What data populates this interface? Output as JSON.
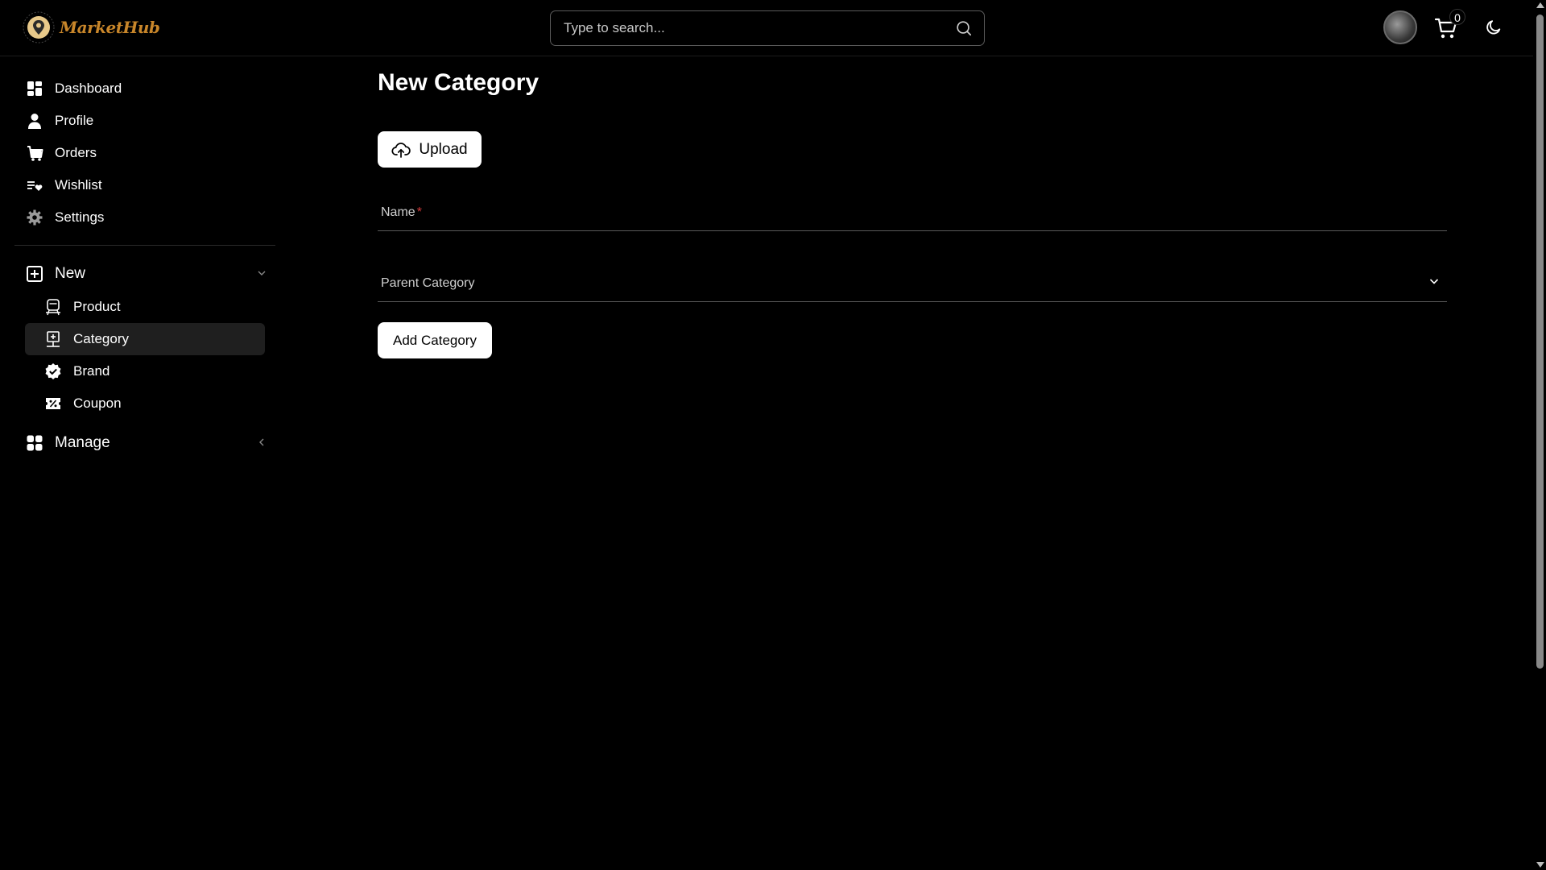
{
  "header": {
    "logo_text": "MarketHub",
    "search_placeholder": "Type to search...",
    "cart_count": "0"
  },
  "sidebar": {
    "items": [
      {
        "label": "Dashboard",
        "icon": "dashboard-icon"
      },
      {
        "label": "Profile",
        "icon": "user-icon"
      },
      {
        "label": "Orders",
        "icon": "orders-icon"
      },
      {
        "label": "Wishlist",
        "icon": "wishlist-icon"
      },
      {
        "label": "Settings",
        "icon": "gear-icon"
      }
    ],
    "new_group": {
      "label": "New",
      "expanded": true,
      "items": [
        {
          "label": "Product",
          "icon": "product-icon"
        },
        {
          "label": "Category",
          "icon": "category-icon",
          "active": true
        },
        {
          "label": "Brand",
          "icon": "brand-badge-icon"
        },
        {
          "label": "Coupon",
          "icon": "coupon-icon"
        }
      ]
    },
    "manage_group": {
      "label": "Manage",
      "expanded": false
    }
  },
  "main": {
    "title": "New Category",
    "upload_label": "Upload",
    "name_label": "Name",
    "required_mark": "*",
    "parent_category_label": "Parent Category",
    "add_button_label": "Add Category"
  },
  "colors": {
    "background": "#000000",
    "accent_logo": "#c8862a",
    "required": "#d23a3a",
    "active_item": "#1f1f1f"
  }
}
